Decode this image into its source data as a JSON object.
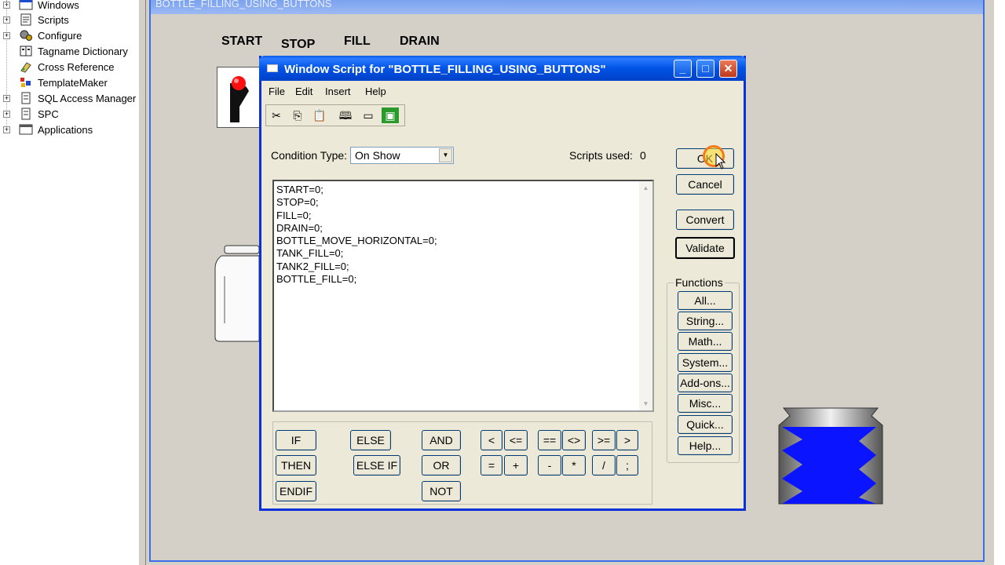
{
  "tree": {
    "items": [
      {
        "label": "Windows",
        "expander": "+",
        "icon": "windows-icon"
      },
      {
        "label": "Scripts",
        "expander": "+",
        "icon": "scripts-icon"
      },
      {
        "label": "Configure",
        "expander": "+",
        "icon": "configure-icon"
      },
      {
        "label": "Tagname Dictionary",
        "expander": "",
        "icon": "dictionary-icon"
      },
      {
        "label": "Cross Reference",
        "expander": "",
        "icon": "cross-reference-icon"
      },
      {
        "label": "TemplateMaker",
        "expander": "",
        "icon": "template-maker-icon"
      },
      {
        "label": "SQL Access Manager",
        "expander": "+",
        "icon": "sql-icon"
      },
      {
        "label": "SPC",
        "expander": "+",
        "icon": "spc-icon"
      },
      {
        "label": "Applications",
        "expander": "+",
        "icon": "applications-icon"
      }
    ]
  },
  "canvas": {
    "title": "BOTTLE_FILLING_USING_BUTTONS",
    "buttons": [
      "START",
      "STOP",
      "FILL",
      "DRAIN"
    ],
    "colors": {
      "tank_fill": "#0000ff",
      "switch_knob": "#ff0000"
    }
  },
  "dialog": {
    "title": "Window Script for \"BOTTLE_FILLING_USING_BUTTONS\"",
    "menu": [
      "File",
      "Edit",
      "Insert",
      "Help"
    ],
    "toolbar": [
      "cut-icon",
      "copy-icon",
      "paste-icon",
      "find-icon",
      "window-icon",
      "image-icon"
    ],
    "condition_label": "Condition Type:",
    "condition_value": "On Show",
    "scripts_used_label": "Scripts used:",
    "scripts_used_value": "0",
    "script_lines": [
      "START=0;",
      "STOP=0;",
      "FILL=0;",
      "DRAIN=0;",
      "BOTTLE_MOVE_HORIZONTAL=0;",
      "TANK_FILL=0;",
      "TANK2_FILL=0;",
      "BOTTLE_FILL=0;"
    ],
    "ok": "OK",
    "cancel": "Cancel",
    "convert": "Convert",
    "validate": "Validate",
    "functions_label": "Functions",
    "functions": [
      "All...",
      "String...",
      "Math...",
      "System...",
      "Add-ons...",
      "Misc...",
      "Quick...",
      "Help..."
    ],
    "keywords": {
      "if": "IF",
      "then": "THEN",
      "endif": "ENDIF",
      "else": "ELSE",
      "elseif": "ELSE IF",
      "and": "AND",
      "or": "OR",
      "not": "NOT"
    },
    "operators_row1": [
      "<",
      "<=",
      "==",
      "<>",
      ">=",
      ">"
    ],
    "operators_row2": [
      "=",
      "+",
      "-",
      "*",
      "/",
      ";"
    ]
  }
}
